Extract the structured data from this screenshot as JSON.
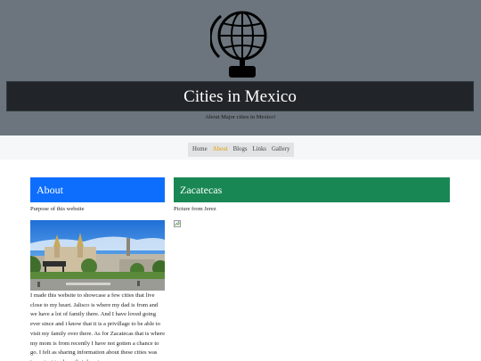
{
  "header": {
    "logo_icon": "globe-stand-icon",
    "title": "Cities in Mexico",
    "subtitle": "About Major cities in Mexico!",
    "bg_color": "#6c757d",
    "title_bg_color": "#212529"
  },
  "nav": {
    "items": [
      {
        "label": "Home",
        "active": false
      },
      {
        "label": "About",
        "active": true
      },
      {
        "label": "Blogs",
        "active": false
      },
      {
        "label": "Links",
        "active": false
      },
      {
        "label": "Gallery",
        "active": false
      }
    ],
    "active_color": "#e0a000"
  },
  "about": {
    "heading": "About",
    "heading_color": "#0d6efd",
    "purpose": "Purpose of this website",
    "photo_icon": "city-plaza-photo",
    "text": "I made this website to showcase a few cities that live close to my heart. Jalisco is where my dad is from and we have a lot of family there. And I have loved going ever since and i know that it is a privillage to be able to visit my family over there. As for Zacatecas that is where my mom is from recently I have not gotten a chance to go. I felt as sharing information about these cities was important to show their beauty."
  },
  "zacatecas": {
    "heading": "Zacatecas",
    "heading_color": "#198754",
    "caption": "Picture from Jerez",
    "image_icon": "broken-image-icon"
  }
}
